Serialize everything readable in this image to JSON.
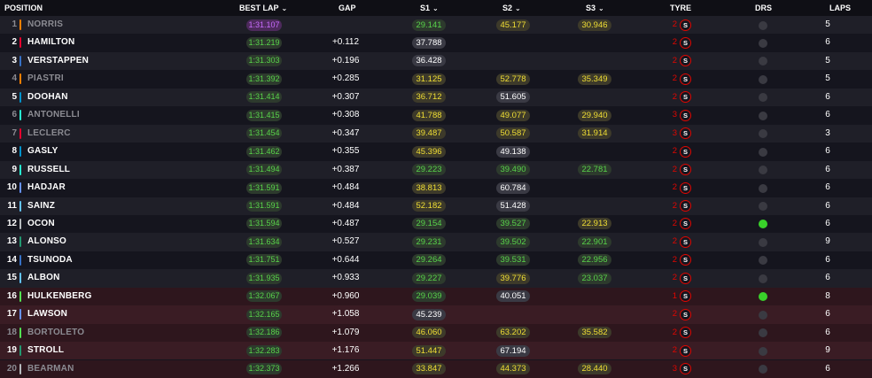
{
  "header": {
    "position": "POSITION",
    "best_lap": "BEST LAP",
    "gap": "GAP",
    "s1": "S1",
    "s2": "S2",
    "s3": "S3",
    "tyre": "TYRE",
    "drs": "DRS",
    "laps": "LAPS",
    "sort_icon": "chevron-down-icon"
  },
  "tyre_compound": "S",
  "colors": {
    "purple": "#c96cff",
    "green": "#58d34a",
    "yellow": "#f1df34",
    "white": "#ffffff",
    "soft_tyre": "#e10600",
    "drs_open": "#39d12a",
    "eliminated_row": "#3a1c24"
  },
  "drivers": [
    {
      "pos": "1",
      "name": "NORRIS",
      "team_color": "#ff8000",
      "best": "1:31.107",
      "best_color": "purple",
      "gap": "",
      "s1": "29.141",
      "s1_color": "green",
      "s2": "45.177",
      "s2_color": "yellow",
      "s3": "30.946",
      "s3_color": "yellow",
      "tyre_age": "2",
      "drs": false,
      "laps": "5",
      "faded": true,
      "eliminated": false
    },
    {
      "pos": "2",
      "name": "HAMILTON",
      "team_color": "#e8002d",
      "best": "1:31.219",
      "best_color": "green",
      "gap": "+0.112",
      "s1": "37.788",
      "s1_color": "white",
      "s2": "",
      "s2_color": "",
      "s3": "",
      "s3_color": "",
      "tyre_age": "2",
      "drs": false,
      "laps": "6",
      "faded": false,
      "eliminated": false
    },
    {
      "pos": "3",
      "name": "VERSTAPPEN",
      "team_color": "#3671c6",
      "best": "1:31.303",
      "best_color": "green",
      "gap": "+0.196",
      "s1": "36.428",
      "s1_color": "white",
      "s2": "",
      "s2_color": "",
      "s3": "",
      "s3_color": "",
      "tyre_age": "2",
      "drs": false,
      "laps": "5",
      "faded": false,
      "eliminated": false
    },
    {
      "pos": "4",
      "name": "PIASTRI",
      "team_color": "#ff8000",
      "best": "1:31.392",
      "best_color": "green",
      "gap": "+0.285",
      "s1": "31.125",
      "s1_color": "yellow",
      "s2": "52.778",
      "s2_color": "yellow",
      "s3": "35.349",
      "s3_color": "yellow",
      "tyre_age": "2",
      "drs": false,
      "laps": "5",
      "faded": true,
      "eliminated": false
    },
    {
      "pos": "5",
      "name": "DOOHAN",
      "team_color": "#0093cc",
      "best": "1:31.414",
      "best_color": "green",
      "gap": "+0.307",
      "s1": "36.712",
      "s1_color": "yellow",
      "s2": "51.605",
      "s2_color": "white",
      "s3": "",
      "s3_color": "",
      "tyre_age": "2",
      "drs": false,
      "laps": "6",
      "faded": false,
      "eliminated": false
    },
    {
      "pos": "6",
      "name": "ANTONELLI",
      "team_color": "#27f4d2",
      "best": "1:31.415",
      "best_color": "green",
      "gap": "+0.308",
      "s1": "41.788",
      "s1_color": "yellow",
      "s2": "49.077",
      "s2_color": "yellow",
      "s3": "29.940",
      "s3_color": "yellow",
      "tyre_age": "3",
      "drs": false,
      "laps": "6",
      "faded": true,
      "eliminated": false
    },
    {
      "pos": "7",
      "name": "LECLERC",
      "team_color": "#e8002d",
      "best": "1:31.454",
      "best_color": "green",
      "gap": "+0.347",
      "s1": "39.487",
      "s1_color": "yellow",
      "s2": "50.587",
      "s2_color": "yellow",
      "s3": "31.914",
      "s3_color": "yellow",
      "tyre_age": "3",
      "drs": false,
      "laps": "3",
      "faded": true,
      "eliminated": false
    },
    {
      "pos": "8",
      "name": "GASLY",
      "team_color": "#0093cc",
      "best": "1:31.462",
      "best_color": "green",
      "gap": "+0.355",
      "s1": "45.396",
      "s1_color": "yellow",
      "s2": "49.138",
      "s2_color": "white",
      "s3": "",
      "s3_color": "",
      "tyre_age": "2",
      "drs": false,
      "laps": "6",
      "faded": false,
      "eliminated": false
    },
    {
      "pos": "9",
      "name": "RUSSELL",
      "team_color": "#27f4d2",
      "best": "1:31.494",
      "best_color": "green",
      "gap": "+0.387",
      "s1": "29.223",
      "s1_color": "green",
      "s2": "39.490",
      "s2_color": "green",
      "s3": "22.781",
      "s3_color": "green",
      "tyre_age": "2",
      "drs": false,
      "laps": "6",
      "faded": false,
      "eliminated": false
    },
    {
      "pos": "10",
      "name": "HADJAR",
      "team_color": "#6692ff",
      "best": "1:31.591",
      "best_color": "green",
      "gap": "+0.484",
      "s1": "38.813",
      "s1_color": "yellow",
      "s2": "60.784",
      "s2_color": "white",
      "s3": "",
      "s3_color": "",
      "tyre_age": "2",
      "drs": false,
      "laps": "6",
      "faded": false,
      "eliminated": false
    },
    {
      "pos": "11",
      "name": "SAINZ",
      "team_color": "#64c4ff",
      "best": "1:31.591",
      "best_color": "green",
      "gap": "+0.484",
      "s1": "52.182",
      "s1_color": "yellow",
      "s2": "51.428",
      "s2_color": "white",
      "s3": "",
      "s3_color": "",
      "tyre_age": "2",
      "drs": false,
      "laps": "6",
      "faded": false,
      "eliminated": false
    },
    {
      "pos": "12",
      "name": "OCON",
      "team_color": "#b6babd",
      "best": "1:31.594",
      "best_color": "green",
      "gap": "+0.487",
      "s1": "29.154",
      "s1_color": "green",
      "s2": "39.527",
      "s2_color": "green",
      "s3": "22.913",
      "s3_color": "yellow",
      "tyre_age": "2",
      "drs": true,
      "laps": "6",
      "faded": false,
      "eliminated": false
    },
    {
      "pos": "13",
      "name": "ALONSO",
      "team_color": "#229971",
      "best": "1:31.634",
      "best_color": "green",
      "gap": "+0.527",
      "s1": "29.231",
      "s1_color": "green",
      "s2": "39.502",
      "s2_color": "green",
      "s3": "22.901",
      "s3_color": "green",
      "tyre_age": "2",
      "drs": false,
      "laps": "9",
      "faded": false,
      "eliminated": false
    },
    {
      "pos": "14",
      "name": "TSUNODA",
      "team_color": "#3671c6",
      "best": "1:31.751",
      "best_color": "green",
      "gap": "+0.644",
      "s1": "29.264",
      "s1_color": "green",
      "s2": "39.531",
      "s2_color": "green",
      "s3": "22.956",
      "s3_color": "green",
      "tyre_age": "2",
      "drs": false,
      "laps": "6",
      "faded": false,
      "eliminated": false
    },
    {
      "pos": "15",
      "name": "ALBON",
      "team_color": "#64c4ff",
      "best": "1:31.935",
      "best_color": "green",
      "gap": "+0.933",
      "s1": "29.227",
      "s1_color": "green",
      "s2": "39.776",
      "s2_color": "yellow",
      "s3": "23.037",
      "s3_color": "green",
      "tyre_age": "2",
      "drs": false,
      "laps": "6",
      "faded": false,
      "eliminated": false
    },
    {
      "pos": "16",
      "name": "HULKENBERG",
      "team_color": "#52e252",
      "best": "1:32.067",
      "best_color": "green",
      "gap": "+0.960",
      "s1": "29.039",
      "s1_color": "green",
      "s2": "40.051",
      "s2_color": "white",
      "s3": "",
      "s3_color": "",
      "tyre_age": "1",
      "drs": true,
      "laps": "8",
      "faded": false,
      "eliminated": true
    },
    {
      "pos": "17",
      "name": "LAWSON",
      "team_color": "#6692ff",
      "best": "1:32.165",
      "best_color": "green",
      "gap": "+1.058",
      "s1": "45.239",
      "s1_color": "white",
      "s2": "",
      "s2_color": "",
      "s3": "",
      "s3_color": "",
      "tyre_age": "2",
      "drs": false,
      "laps": "6",
      "faded": false,
      "eliminated": true
    },
    {
      "pos": "18",
      "name": "BORTOLETO",
      "team_color": "#52e252",
      "best": "1:32.186",
      "best_color": "green",
      "gap": "+1.079",
      "s1": "46.060",
      "s1_color": "yellow",
      "s2": "63.202",
      "s2_color": "yellow",
      "s3": "35.582",
      "s3_color": "yellow",
      "tyre_age": "2",
      "drs": false,
      "laps": "6",
      "faded": true,
      "eliminated": true
    },
    {
      "pos": "19",
      "name": "STROLL",
      "team_color": "#229971",
      "best": "1:32.283",
      "best_color": "green",
      "gap": "+1.176",
      "s1": "51.447",
      "s1_color": "yellow",
      "s2": "67.194",
      "s2_color": "white",
      "s3": "",
      "s3_color": "",
      "tyre_age": "2",
      "drs": false,
      "laps": "9",
      "faded": false,
      "eliminated": true
    },
    {
      "pos": "20",
      "name": "BEARMAN",
      "team_color": "#b6babd",
      "best": "1:32.373",
      "best_color": "green",
      "gap": "+1.266",
      "s1": "33.847",
      "s1_color": "yellow",
      "s2": "44.373",
      "s2_color": "yellow",
      "s3": "28.440",
      "s3_color": "yellow",
      "tyre_age": "3",
      "drs": false,
      "laps": "6",
      "faded": true,
      "eliminated": true
    }
  ]
}
